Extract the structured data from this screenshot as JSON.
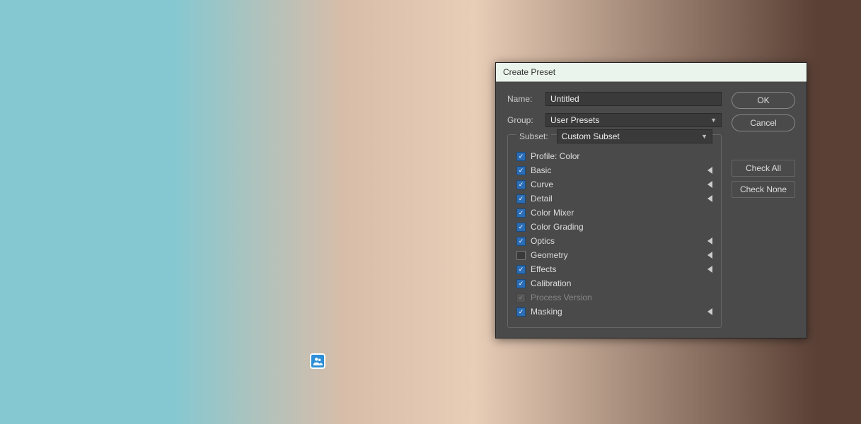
{
  "dialog": {
    "title": "Create Preset",
    "name_label": "Name:",
    "name_value": "Untitled",
    "group_label": "Group:",
    "group_value": "User Presets",
    "subset_label": "Subset:",
    "subset_value": "Custom Subset",
    "items": [
      {
        "label": "Profile: Color",
        "checked": true,
        "expand": false,
        "disabled": false
      },
      {
        "label": "Basic",
        "checked": true,
        "expand": true,
        "disabled": false
      },
      {
        "label": "Curve",
        "checked": true,
        "expand": true,
        "disabled": false
      },
      {
        "label": "Detail",
        "checked": true,
        "expand": true,
        "disabled": false
      },
      {
        "label": "Color Mixer",
        "checked": true,
        "expand": false,
        "disabled": false
      },
      {
        "label": "Color Grading",
        "checked": true,
        "expand": false,
        "disabled": false
      },
      {
        "label": "Optics",
        "checked": true,
        "expand": true,
        "disabled": false
      },
      {
        "label": "Geometry",
        "checked": false,
        "expand": true,
        "disabled": false
      },
      {
        "label": "Effects",
        "checked": true,
        "expand": true,
        "disabled": false
      },
      {
        "label": "Calibration",
        "checked": true,
        "expand": false,
        "disabled": false
      },
      {
        "label": "Process Version",
        "checked": true,
        "expand": false,
        "disabled": true
      },
      {
        "label": "Masking",
        "checked": true,
        "expand": true,
        "disabled": false
      }
    ],
    "buttons": {
      "ok": "OK",
      "cancel": "Cancel",
      "check_all": "Check All",
      "check_none": "Check None"
    }
  }
}
